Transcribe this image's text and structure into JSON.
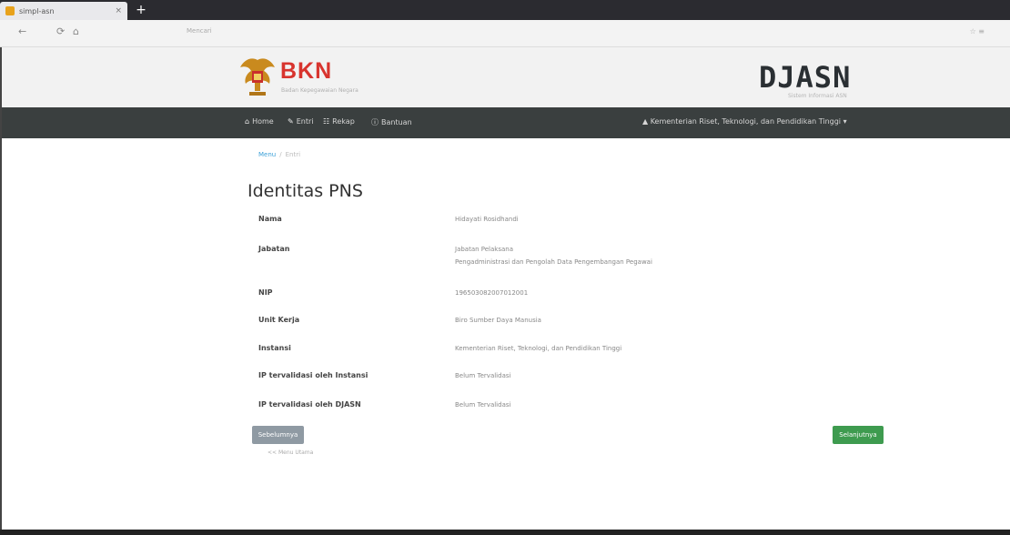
{
  "browser": {
    "tab_title": "simpl-asn",
    "tab_close": "×",
    "new_tab": "+",
    "url": "Mencari",
    "back": "←",
    "reload": "⟳",
    "home": "⌂",
    "menu": "☆ ≡"
  },
  "header": {
    "logo_text": "BKN",
    "logo_subtitle": "Badan Kepegawaian Negara",
    "app_title": "DJASN",
    "app_subtitle": "Sistem Informasi ASN"
  },
  "nav": {
    "items": [
      {
        "icon": "home-icon",
        "label": "Home",
        "glyph": "⌂"
      },
      {
        "icon": "pencil-icon",
        "label": "Entri",
        "glyph": "✎"
      },
      {
        "icon": "group-icon",
        "label": "Rekap",
        "glyph": "☷"
      },
      {
        "icon": "info-icon",
        "label": "Bantuan",
        "glyph": "ⓘ"
      }
    ],
    "user": "▲ Kementerian Riset, Teknologi, dan Pendidikan Tinggi ▾"
  },
  "breadcrumb": {
    "link": "Menu",
    "separator": "/",
    "current": "Entri"
  },
  "page_title": "Identitas PNS",
  "fields": [
    {
      "label": "Nama",
      "value": "Hidayati Rosidhandi",
      "value2": ""
    },
    {
      "label": "Jabatan",
      "value": "Jabatan Pelaksana",
      "value2": "Pengadministrasi dan Pengolah Data Pengembangan Pegawai"
    },
    {
      "label": "NIP",
      "value": "196503082007012001",
      "value2": ""
    },
    {
      "label": "Unit Kerja",
      "value": "Biro Sumber Daya Manusia",
      "value2": ""
    },
    {
      "label": "Instansi",
      "value": "Kementerian Riset, Teknologi, dan Pendidikan Tinggi",
      "value2": ""
    },
    {
      "label": "IP tervalidasi oleh Instansi",
      "value": "Belum Tervalidasi",
      "value2": ""
    },
    {
      "label": "IP tervalidasi oleh DJASN",
      "value": "Belum Tervalidasi",
      "value2": ""
    }
  ],
  "buttons": {
    "prev": "Sebelumnya",
    "prev_note": "<< Menu Utama",
    "next": "Selanjutnya"
  },
  "colors": {
    "brand_red": "#d8342e",
    "nav_bg": "#3a3f3f",
    "next_green": "#3e9b4f",
    "prev_gray": "#8f9aa3",
    "link_blue": "#3ca0d8"
  }
}
